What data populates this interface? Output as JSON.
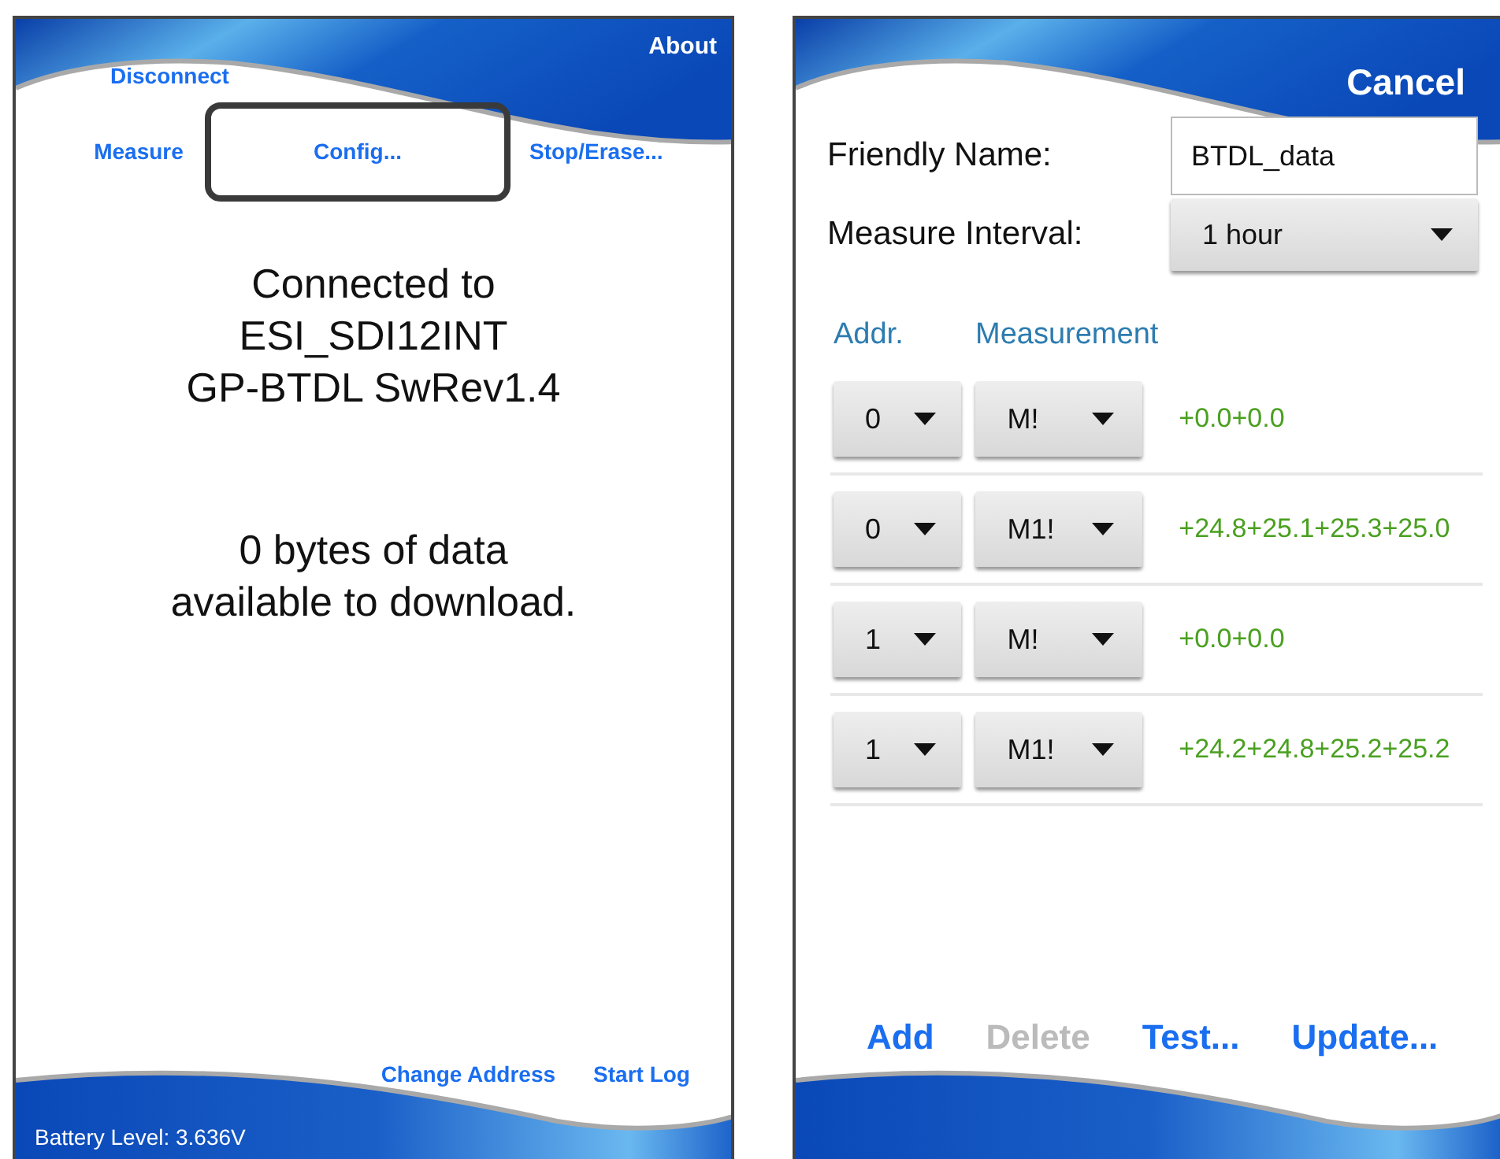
{
  "main_screen": {
    "about": "About",
    "disconnect": "Disconnect",
    "nav": [
      {
        "label": "Measure",
        "highlighted": false
      },
      {
        "label": "Config...",
        "highlighted": true
      },
      {
        "label": "Stop/Erase...",
        "highlighted": false
      }
    ],
    "connection_lines": [
      "Connected to",
      "ESI_SDI12INT",
      "GP-BTDL SwRev1.4"
    ],
    "data_lines": [
      "0 bytes of data",
      "available to download."
    ],
    "footer_links": [
      "Change Address",
      "Start Log"
    ],
    "battery": "Battery Level: 3.636V"
  },
  "config_screen": {
    "cancel": "Cancel",
    "friendly_name": {
      "label": "Friendly Name:",
      "value": "BTDL_data"
    },
    "measure_interval": {
      "label": "Measure Interval:",
      "value": "1 hour"
    },
    "columns": [
      "Addr.",
      "Measurement"
    ],
    "rows": [
      {
        "addr": "0",
        "command": "M!",
        "reading": "+0.0+0.0"
      },
      {
        "addr": "0",
        "command": "M1!",
        "reading": "+24.8+25.1+25.3+25.0"
      },
      {
        "addr": "1",
        "command": "M!",
        "reading": "+0.0+0.0"
      },
      {
        "addr": "1",
        "command": "M1!",
        "reading": "+24.2+24.8+25.2+25.2"
      }
    ],
    "buttons": [
      {
        "label": "Add",
        "disabled": false
      },
      {
        "label": "Delete",
        "disabled": true
      },
      {
        "label": "Test...",
        "disabled": false
      },
      {
        "label": "Update...",
        "disabled": false
      }
    ]
  }
}
